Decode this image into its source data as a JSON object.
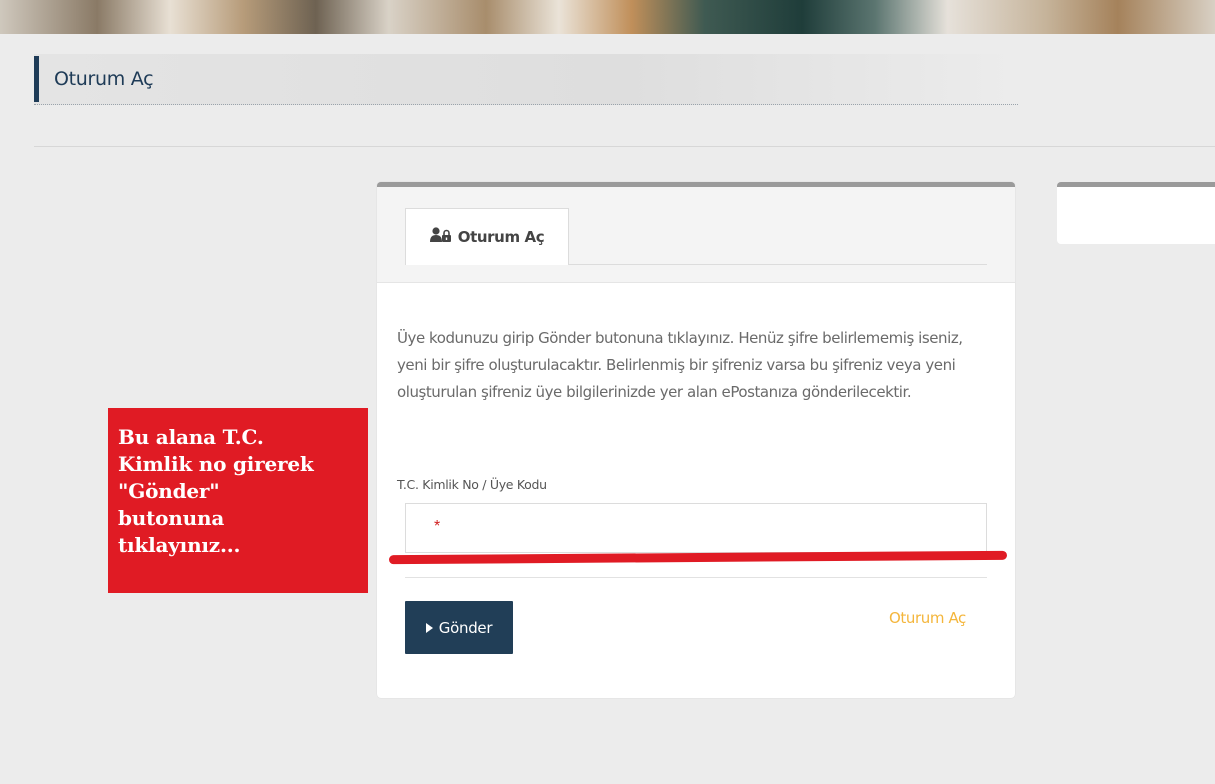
{
  "header": {
    "page_title": "Oturum Aç"
  },
  "login_card": {
    "tab_label": "Oturum Aç",
    "description": "Üye kodunuzu girip Gönder butonuna tıklayınız. Henüz şifre belirlememiş iseniz, yeni bir şifre oluşturulacaktır. Belirlenmiş bir şifreniz varsa bu şifreniz veya yeni oluşturulan şifreniz üye bilgilerinizde yer alan ePostanıza gönderilecektir.",
    "field_label": "T.C. Kimlik No / Üye Kodu",
    "field_value": "",
    "required_marker": "*",
    "submit_label": "Gönder",
    "alt_link_label": "Oturum Aç"
  },
  "callout": {
    "text": "Bu alana T.C.\nKimlik no girerek\n\"Gönder\"\nbutonuna\ntıklayınız..."
  },
  "icons": {
    "tab_icon": "user-lock-icon",
    "submit_icon": "caret-right-icon"
  },
  "colors": {
    "accent_navy": "#1e3b57",
    "button_navy": "#213e57",
    "link_gold": "#f4b63c",
    "annotation_red": "#e01b24"
  }
}
